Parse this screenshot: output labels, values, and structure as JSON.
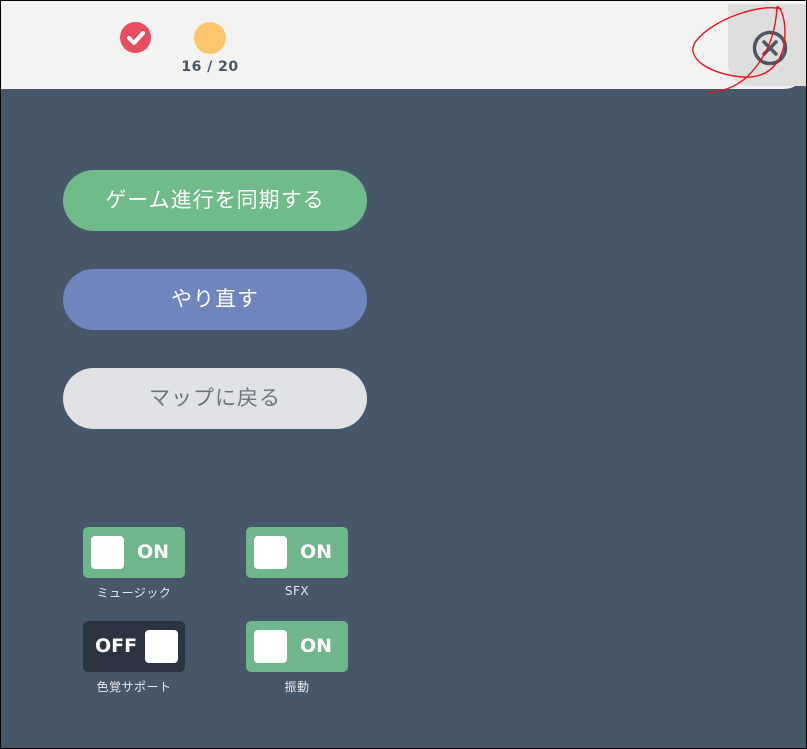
{
  "header": {
    "progress_counter": "16 / 20",
    "progress_icons": [
      "check-circle-icon",
      "current-level-dot-icon"
    ],
    "close_icon": "close-circle-icon"
  },
  "menu": {
    "sync_label": "ゲーム進行を同期する",
    "retry_label": "やり直す",
    "map_label": "マップに戻る"
  },
  "settings": {
    "music": {
      "state": "ON",
      "label": "ミュージック",
      "enabled": true
    },
    "sfx": {
      "state": "ON",
      "label": "SFX",
      "enabled": true
    },
    "colorblind": {
      "state": "OFF",
      "label": "色覚サポート",
      "enabled": false
    },
    "vibration": {
      "state": "ON",
      "label": "振動",
      "enabled": true
    }
  },
  "colors": {
    "background": "#47576a",
    "topbar": "#f3f3f2",
    "sync_button": "#6fbb8a",
    "retry_button": "#6e86bd",
    "map_button": "#e1e2e6",
    "toggle_on": "#6fb68b",
    "toggle_off": "#2c3442",
    "done_marker": "#e84c5e",
    "current_marker": "#fcc76a",
    "annotation_scribble": "#e8141e"
  }
}
